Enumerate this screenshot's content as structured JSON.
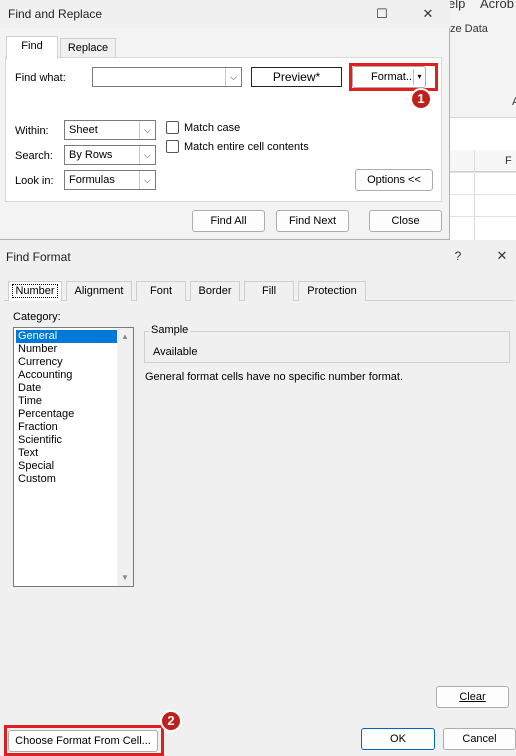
{
  "background": {
    "ribbon_fragments": [
      "elp",
      "Acrob",
      "ze Data",
      "A"
    ],
    "column_header": "F"
  },
  "find_replace": {
    "title": "Find and Replace",
    "tabs": [
      {
        "label": "Find",
        "active": true
      },
      {
        "label": "Replace",
        "active": false
      }
    ],
    "find_what_label": "Find what:",
    "find_what_value": "",
    "preview_label": "Preview*",
    "format_label": "Format...",
    "within_label": "Within:",
    "within_value": "Sheet",
    "search_label": "Search:",
    "search_value": "By Rows",
    "lookin_label": "Look in:",
    "lookin_value": "Formulas",
    "match_case_label": "Match case",
    "match_case_checked": false,
    "match_entire_label": "Match entire cell contents",
    "match_entire_checked": false,
    "options_label": "Options <<",
    "find_all_label": "Find All",
    "find_next_label": "Find Next",
    "close_label": "Close",
    "callout_1": "1"
  },
  "find_format": {
    "title": "Find Format",
    "help_glyph": "?",
    "tabs": [
      "Number",
      "Alignment",
      "Font",
      "Border",
      "Fill",
      "Protection"
    ],
    "active_tab": "Number",
    "category_label": "Category:",
    "categories": [
      "General",
      "Number",
      "Currency",
      "Accounting",
      "Date",
      "Time",
      "Percentage",
      "Fraction",
      "Scientific",
      "Text",
      "Special",
      "Custom"
    ],
    "selected_category": "General",
    "sample_label": "Sample",
    "sample_value": "Available",
    "description": "General format cells have no specific number format.",
    "clear_label": "Clear",
    "choose_format_label": "Choose Format From Cell...",
    "ok_label": "OK",
    "cancel_label": "Cancel",
    "callout_2": "2"
  },
  "colors": {
    "highlight": "#e02020",
    "callout": "#c0201c",
    "selection": "#0078d7"
  }
}
